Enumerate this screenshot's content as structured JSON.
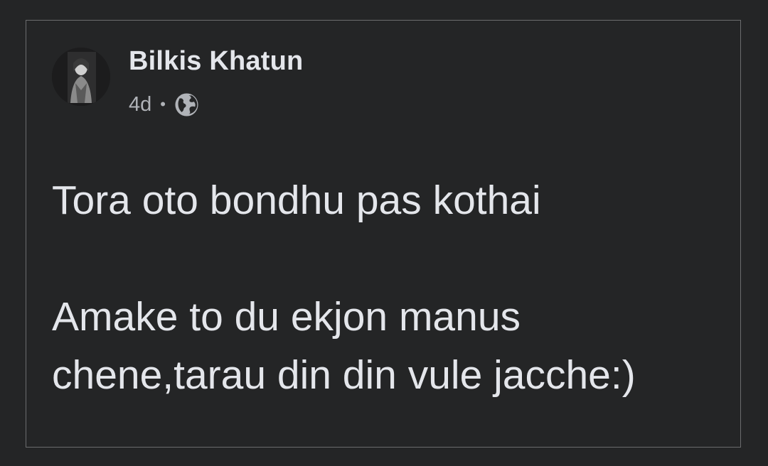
{
  "post": {
    "author_name": "Bilkis Khatun",
    "timestamp": "4d",
    "separator": "•",
    "privacy_icon": "globe-icon",
    "text": "Tora oto bondhu pas kothai\n\nAmake to du ekjon manus chene,tarau din din vule jacche:)"
  },
  "colors": {
    "background": "#242526",
    "card_border": "#6b6c6e",
    "primary_text": "#e4e6eb",
    "secondary_text": "#b0b3b8"
  }
}
